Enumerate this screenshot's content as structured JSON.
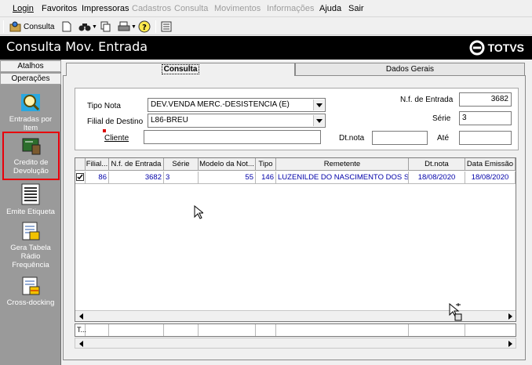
{
  "menu": {
    "items": [
      {
        "label": "Login",
        "enabled": true
      },
      {
        "label": "Favoritos",
        "enabled": true
      },
      {
        "label": "Impressoras",
        "enabled": true
      },
      {
        "label": "Cadastros",
        "enabled": false
      },
      {
        "label": "Consulta",
        "enabled": false
      },
      {
        "label": "Movimentos",
        "enabled": false
      },
      {
        "label": "Informações",
        "enabled": false
      },
      {
        "label": "Ajuda",
        "enabled": true
      },
      {
        "label": "Sair",
        "enabled": true
      }
    ]
  },
  "toolbar": {
    "consulta_label": "Consulta",
    "icons": [
      "consulta-icon",
      "new-document-icon",
      "binoculars-icon",
      "copy-icon",
      "printer-icon",
      "help-icon",
      "calendar-icon"
    ]
  },
  "title_bar": {
    "title": "Consulta Mov. Entrada",
    "logo": "TOTVS"
  },
  "left_panel": {
    "atalhos_label": "Atalhos",
    "operacoes_label": "Operações",
    "items": [
      {
        "label": "Entradas por Item",
        "icon": "magnifier-icon"
      },
      {
        "label": "Credito de Devolução",
        "icon": "credit-board-icon",
        "highlighted": true
      },
      {
        "label": "Emite Etiqueta",
        "icon": "barcode-label-icon"
      },
      {
        "label": "Gera Tabela Rádio Frequência",
        "icon": "table-document-icon"
      },
      {
        "label": "Cross-docking",
        "icon": "crossdocking-document-icon"
      }
    ],
    "highlight_color": "#e8000b"
  },
  "tabs": [
    {
      "label": "Consulta",
      "active": true
    },
    {
      "label": "Dados Gerais",
      "active": false
    }
  ],
  "form": {
    "tipo_nota_label": "Tipo Nota",
    "tipo_nota_value": "DEV.VENDA MERC.-DESISTENCIA (E)",
    "filial_destino_label": "Filial de Destino",
    "filial_destino_value": "L86-BREU",
    "cliente_label": "Cliente",
    "cliente_value": "",
    "nf_entrada_label": "N.f. de Entrada",
    "nf_entrada_value": "3682",
    "serie_label": "Série",
    "serie_value": "3",
    "dt_nota_label": "Dt.nota",
    "dt_nota_value": "",
    "ate_label": "Até",
    "ate_value": ""
  },
  "grid": {
    "columns": [
      "Filial...",
      "N.f. de Entrada",
      "Série",
      "Modelo da Not...",
      "Tipo",
      "Remetente",
      "Dt.nota",
      "Data Emissão"
    ],
    "rows": [
      {
        "selected": true,
        "cells": [
          "86",
          "3682",
          "3",
          "55",
          "146",
          "LUZENILDE DO NASCIMENTO DOS SA",
          "18/08/2020",
          "18/08/2020"
        ]
      }
    ],
    "totals_label": "T..."
  }
}
